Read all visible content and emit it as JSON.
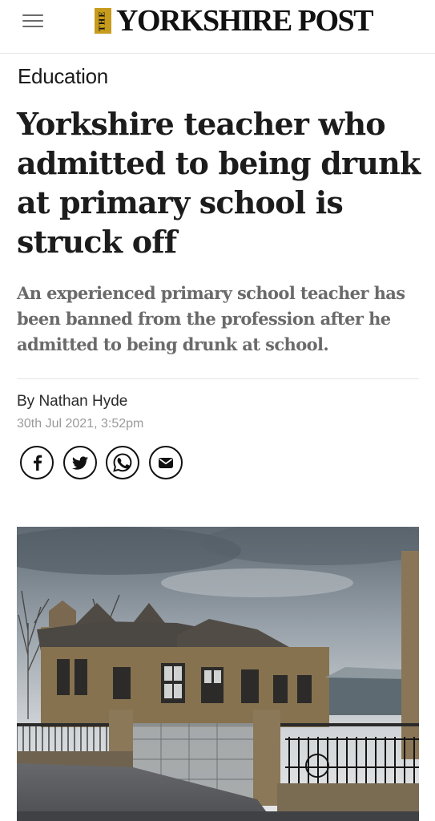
{
  "header": {
    "brand_prefix": "THE",
    "brand_name": "YORKSHIRE POST",
    "menu_icon": "hamburger-menu-icon",
    "brand_color": "#c79b1b"
  },
  "article": {
    "section": "Education",
    "headline": "Yorkshire teacher who admitted to being drunk at primary school is struck off",
    "standfirst": "An experienced primary school teacher has been banned from the profession after he admitted to being drunk at school.",
    "byline": "By Nathan Hyde",
    "date": "30th Jul 2021, 3:52pm"
  },
  "share": {
    "icons": [
      "facebook-icon",
      "twitter-icon",
      "whatsapp-icon",
      "email-icon"
    ]
  }
}
